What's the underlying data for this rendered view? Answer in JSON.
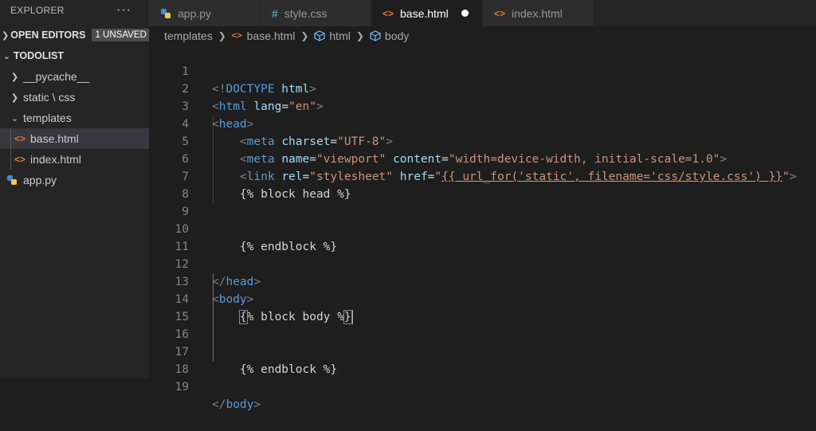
{
  "sidebar": {
    "title": "EXPLORER",
    "more": "···",
    "open_editors": {
      "label": "OPEN EDITORS",
      "badge": "1 UNSAVED"
    },
    "project": "TODOLIST",
    "tree": [
      {
        "label": "__pycache__",
        "kind": "folder",
        "expanded": false
      },
      {
        "label": "static \\ css",
        "kind": "folder",
        "expanded": false
      },
      {
        "label": "templates",
        "kind": "folder",
        "expanded": true
      },
      {
        "label": "base.html",
        "kind": "html",
        "selected": true
      },
      {
        "label": "index.html",
        "kind": "html"
      },
      {
        "label": "app.py",
        "kind": "python"
      }
    ]
  },
  "tabs": [
    {
      "label": "app.py",
      "icon": "python-icon",
      "active": false
    },
    {
      "label": "style.css",
      "icon": "css-icon",
      "active": false
    },
    {
      "label": "base.html",
      "icon": "html-icon",
      "active": true,
      "unsaved": true
    },
    {
      "label": "index.html",
      "icon": "html-icon",
      "active": false
    }
  ],
  "breadcrumb": {
    "folder": "templates",
    "file": "base.html",
    "node1": "html",
    "node2": "body"
  },
  "editor": {
    "line_numbers": [
      "1",
      "2",
      "3",
      "4",
      "5",
      "6",
      "7",
      "8",
      "9",
      "10",
      "11",
      "12",
      "13",
      "14",
      "15",
      "16",
      "17",
      "18",
      "19"
    ],
    "l1_a": "<!",
    "l1_b": "DOCTYPE",
    "l1_c": " html",
    "l1_d": ">",
    "l2_tag": "html",
    "l2_attr": "lang",
    "l2_val": "\"en\"",
    "l3_tag": "head",
    "l4_tag": "meta",
    "l4_attr": "charset",
    "l4_val": "\"UTF-8\"",
    "l5_tag": "meta",
    "l5_attr1": "name",
    "l5_val1": "\"viewport\"",
    "l5_attr2": "content",
    "l5_val2": "\"width=device-width, initial-scale=1.0\"",
    "l6_tag": "link",
    "l6_attr1": "rel",
    "l6_val1": "\"stylesheet\"",
    "l6_attr2": "href",
    "l6_val2a": "\"",
    "l6_val2b": "{{ url_for('static', filename='css/style.css') }}",
    "l6_val2c": "\"",
    "l7": "{% block head %}",
    "l10": "{% endblock %}",
    "l12_tag": "head",
    "l13_tag": "body",
    "l14_open": "{",
    "l14_mid": "% block body %",
    "l14_close": "}",
    "l17": "{% endblock %}",
    "l19_tag": "body"
  }
}
